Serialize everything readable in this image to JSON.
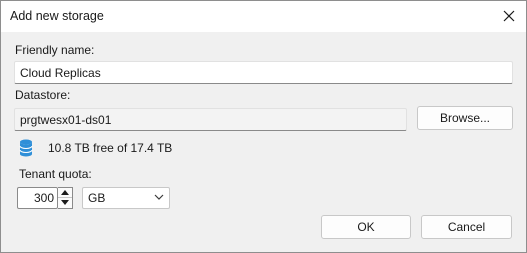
{
  "dialog": {
    "title": "Add new storage",
    "close_icon": "close-icon"
  },
  "friendly_name": {
    "label": "Friendly name:",
    "value": "Cloud Replicas"
  },
  "datastore": {
    "label": "Datastore:",
    "value": "prgtwesx01-ds01",
    "browse_label": "Browse...",
    "icon": "database-icon",
    "free_space_text": "10.8 TB free of 17.4 TB"
  },
  "tenant_quota": {
    "label": "Tenant quota:",
    "value": "300",
    "unit_selected": "GB"
  },
  "buttons": {
    "ok_label": "OK",
    "cancel_label": "Cancel"
  },
  "colors": {
    "accent": "#0067c0",
    "database_icon": "#2f8fd8"
  }
}
